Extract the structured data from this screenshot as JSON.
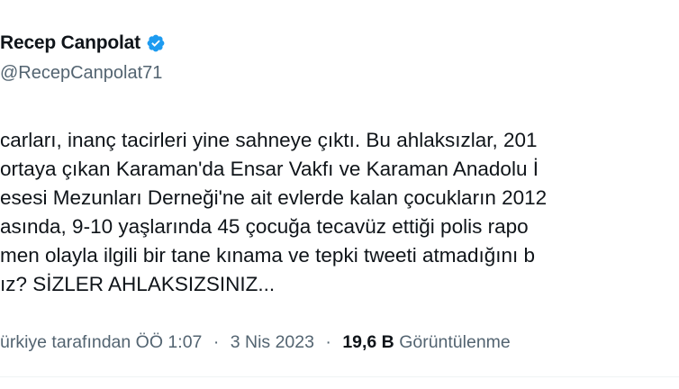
{
  "author": {
    "display_name": "Recep Canpolat",
    "handle": "@RecepCanpolat71",
    "verified_icon": "verified-badge-icon",
    "verified_color": "#1d9bf0"
  },
  "tweet": {
    "lines": [
      "carları, inanç tacirleri yine sahneye çıktı. Bu ahlaksızlar, 201",
      "ortaya çıkan Karaman'da Ensar Vakfı ve Karaman Anadolu İ",
      "esesi Mezunları Derneği'ne ait evlerde kalan çocukların 2012",
      "asında, 9-10 yaşlarında 45 çocuğa tecavüz ettiği polis rapo",
      "men olayla ilgili bir tane kınama ve tepki tweeti atmadığını b",
      "ız? SİZLER AHLAKSIZSINIZ..."
    ]
  },
  "meta": {
    "translated_by": "ürkiye tarafından",
    "time": "ÖÖ 1:07",
    "separator": "·",
    "date": "3 Nis 2023",
    "views_count": "19,6 B",
    "views_label": "Görüntülenme"
  },
  "colors": {
    "text": "#0f1419",
    "secondary": "#536471",
    "accent": "#1d9bf0"
  }
}
